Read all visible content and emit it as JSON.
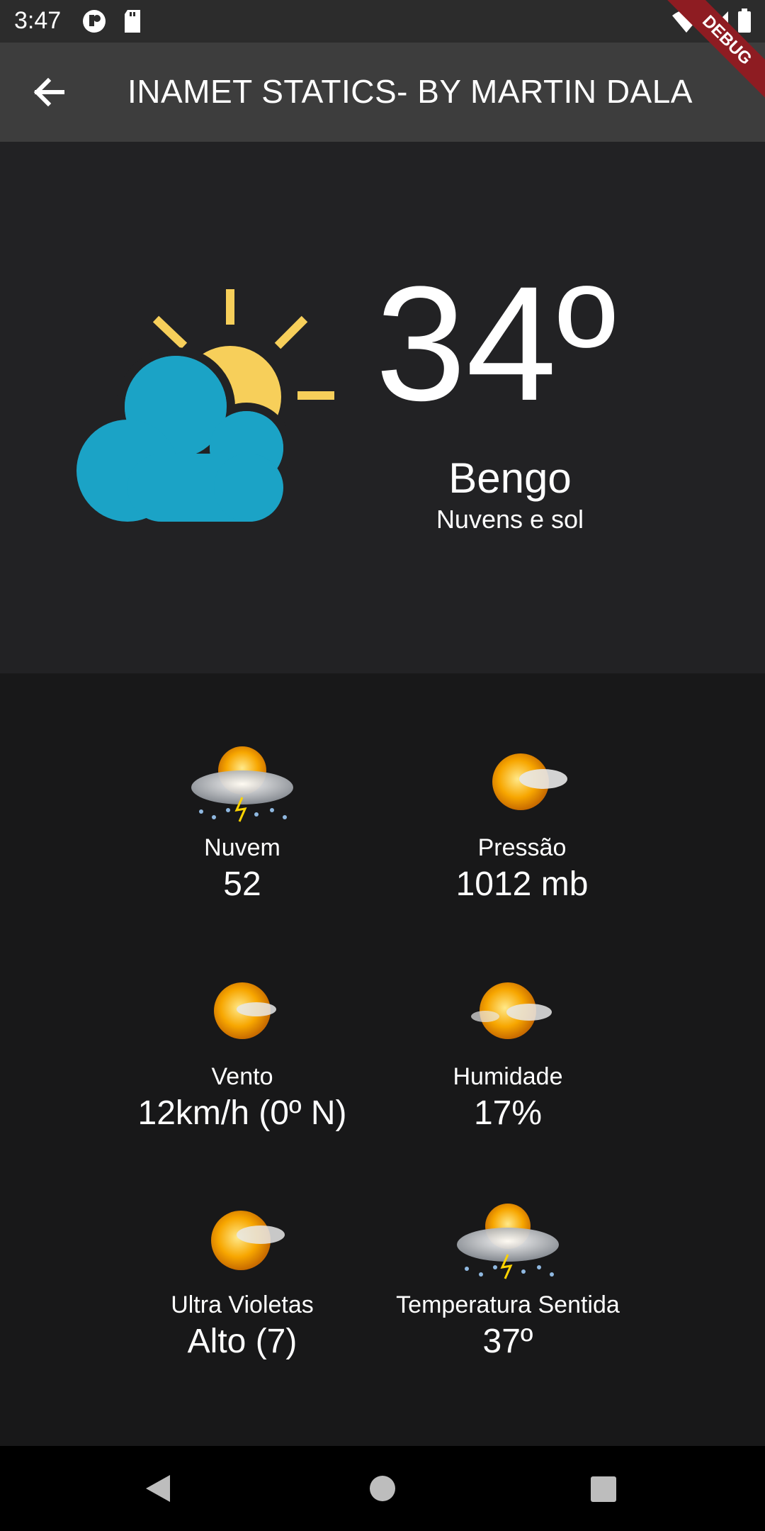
{
  "status_bar": {
    "time": "3:47"
  },
  "app_bar": {
    "title": "INAMET STATICS- BY MARTIN DALA",
    "debug_label": "DEBUG"
  },
  "current": {
    "temperature": "34º",
    "city": "Bengo",
    "condition": "Nuvens e sol"
  },
  "details": [
    {
      "label": "Nuvem",
      "value": "52",
      "icon": "sun-cloud-rain-icon"
    },
    {
      "label": "Pressão",
      "value": "1012 mb",
      "icon": "sun-cloud-icon"
    },
    {
      "label": "Vento",
      "value": "12km/h (0º N)",
      "icon": "sun-cloud-icon"
    },
    {
      "label": "Humidade",
      "value": "17%",
      "icon": "sun-cloud-icon"
    },
    {
      "label": "Ultra Violetas",
      "value": "Alto (7)",
      "icon": "sun-cloud-icon"
    },
    {
      "label": "Temperatura Sentida",
      "value": "37º",
      "icon": "sun-cloud-rain-icon"
    }
  ],
  "colors": {
    "cloud": "#1ba3c6",
    "sun": "#f7cf5a",
    "hero_bg": "#222224",
    "details_bg": "#181819",
    "app_bar": "#3d3d3d"
  }
}
